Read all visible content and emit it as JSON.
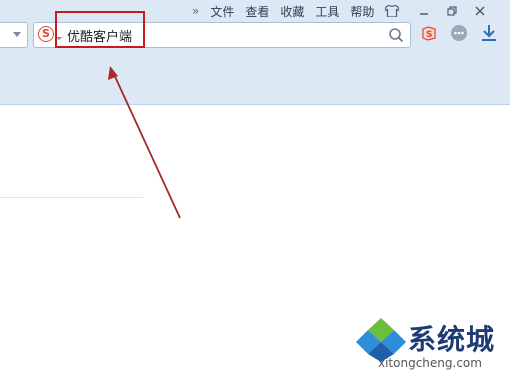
{
  "menu": {
    "overflow_chevron": "»",
    "items": [
      "文件",
      "查看",
      "收藏",
      "工具",
      "帮助"
    ]
  },
  "search": {
    "query": "优酷客户端",
    "engine_logo": "S"
  },
  "watermark": {
    "cn_text": "系统城",
    "url": "xitongcheng.com"
  },
  "colors": {
    "toolbar_bg": "#dde8f5",
    "highlight": "#c9191f",
    "brand_red": "#e2462e",
    "download_blue": "#2f6fb8"
  },
  "icons": [
    "skin-shirt-icon",
    "minimize-icon",
    "restore-icon",
    "close-icon",
    "sogou-search-icon",
    "magnifier-icon",
    "extension-red-icon",
    "extension-gray-icon",
    "download-icon",
    "red-arrow-annotation"
  ]
}
